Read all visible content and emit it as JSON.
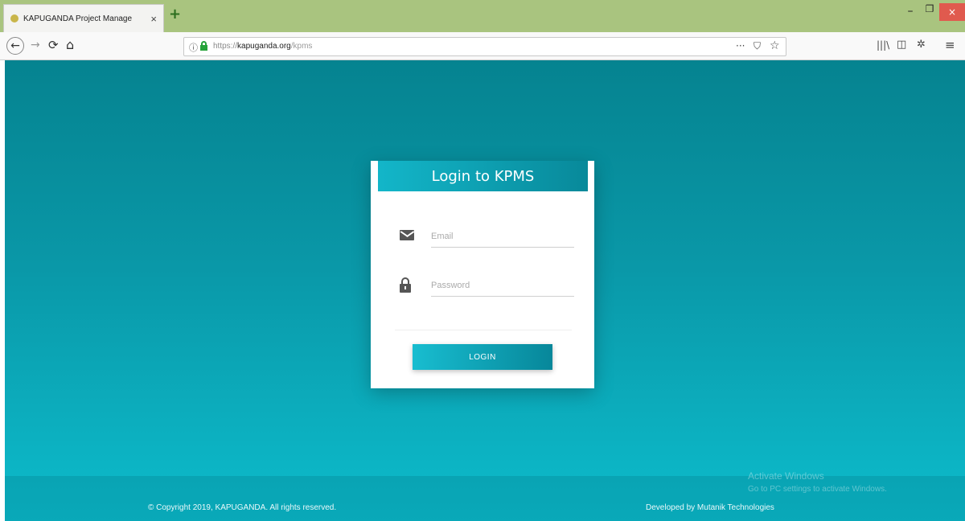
{
  "browser": {
    "tab_title": "KAPUGANDA Project Manage",
    "tab_close": "×",
    "new_tab": "+",
    "url_protocol": "https://",
    "url_domain": "kapuganda.org",
    "url_path": "/kpms",
    "window_min": "–",
    "window_max": "❐",
    "window_close": "×"
  },
  "login": {
    "title": "Login to KPMS",
    "email_placeholder": "Email",
    "password_placeholder": "Password",
    "button_label": "LOGIN"
  },
  "footer": {
    "copyright": "© Copyright 2019, KAPUGANDA. All rights reserved.",
    "developer": "Developed by Mutanik Technologies"
  },
  "watermark": {
    "line1": "Activate Windows",
    "line2": "Go to PC settings to activate Windows."
  },
  "colors": {
    "accent": "#0a98a8",
    "button": "#0aa3b6",
    "titlebar": "#a9c47f"
  }
}
